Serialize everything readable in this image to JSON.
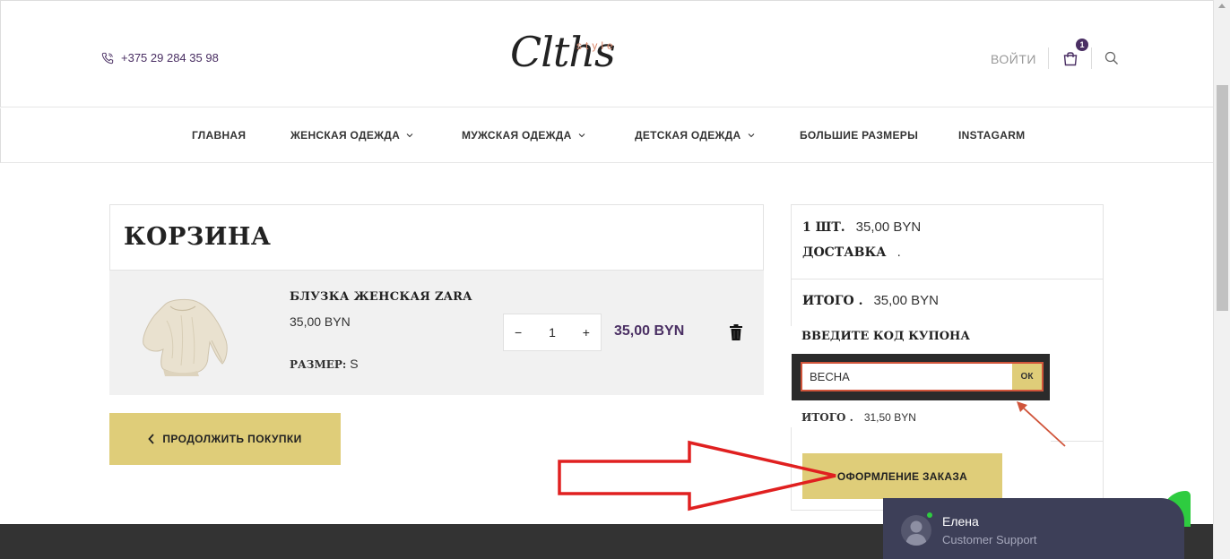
{
  "header": {
    "phone": "+375 29 284 35 98",
    "logo_script": "Clths",
    "logo_tag": "style",
    "login_label": "ВОЙТИ",
    "cart_count": "1"
  },
  "nav": {
    "items": [
      {
        "label": "ГЛАВНАЯ",
        "dropdown": false
      },
      {
        "label": "ЖЕНСКАЯ ОДЕЖДА",
        "dropdown": true
      },
      {
        "label": "МУЖСКАЯ ОДЕЖДА",
        "dropdown": true
      },
      {
        "label": "ДЕТСКАЯ ОДЕЖДА",
        "dropdown": true
      },
      {
        "label": "БОЛЬШИЕ РАЗМЕРЫ",
        "dropdown": false
      },
      {
        "label": "INSTAGARM",
        "dropdown": false
      }
    ]
  },
  "cart": {
    "title": "КОРЗИНА",
    "item": {
      "name": "БЛУЗКА ЖЕНСКАЯ ZARA",
      "price": "35,00 BYN",
      "size_label": "РАЗМЕР:",
      "size_value": "S",
      "qty_minus": "−",
      "qty": "1",
      "qty_plus": "+",
      "line_total": "35,00 BYN"
    },
    "continue_label": "ПРОДОЛЖИТЬ ПОКУПКИ"
  },
  "summary": {
    "count_label": "1 ШТ.",
    "count_value": "35,00 BYN",
    "delivery_label": "ДОСТАВКА",
    "delivery_value": ".",
    "total_label": "ИТОГО .",
    "total_value": "35,00 BYN",
    "coupon_label": "ВВЕДИТЕ КОД КУПОНА",
    "coupon_value": "ВЕСНА",
    "coupon_ok": "ОК",
    "discount_label": "ИТОГО .",
    "discount_value": "31,50 BYN",
    "checkout_label": "ОФОРМЛЕНИЕ ЗАКАЗА"
  },
  "chat": {
    "name": "Елена",
    "role": "Customer Support"
  },
  "colors": {
    "accent": "#dfcd79",
    "brand": "#4a2f63",
    "annotation_red": "#e02020",
    "annotation_coral": "#d0543a",
    "chat_bg": "#3d3f58",
    "online": "#2ecc40"
  }
}
